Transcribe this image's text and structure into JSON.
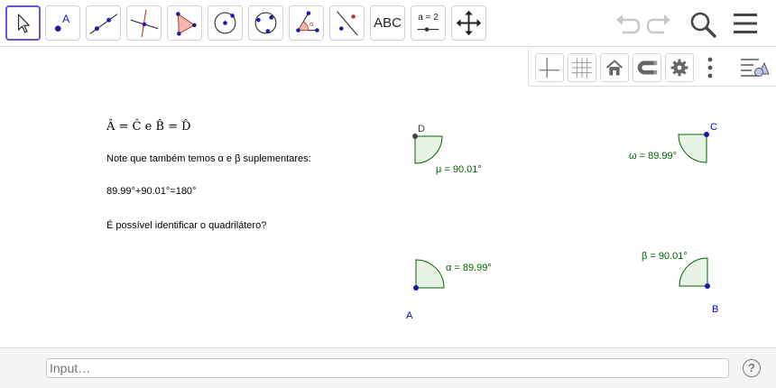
{
  "toolbar": {
    "tools": [
      {
        "name": "move"
      },
      {
        "name": "point",
        "label": "A"
      },
      {
        "name": "line"
      },
      {
        "name": "perpendicular-line"
      },
      {
        "name": "polygon"
      },
      {
        "name": "circle-center-point"
      },
      {
        "name": "circle-three-points"
      },
      {
        "name": "angle",
        "label": "α"
      },
      {
        "name": "reflect-about-line"
      },
      {
        "name": "text",
        "label": "ABC"
      },
      {
        "name": "slider",
        "label": "a = 2"
      },
      {
        "name": "move-graphics-view"
      }
    ],
    "active_color": "#6557d2"
  },
  "text": {
    "equality": "Â = Ĉ e B̂ = D̂",
    "line1": "Note que também temos α e β suplementares:",
    "line2": "89.99°+90.01°=180°",
    "line3": "É possível identificar o quadrilátero?"
  },
  "points": {
    "A": "A",
    "B": "B",
    "C": "C",
    "D": "D"
  },
  "angles": {
    "mu": "μ = 90.01°",
    "omega": "ω = 89.99°",
    "alpha": "α = 89.99°",
    "beta": "β = 90.01°"
  },
  "colors": {
    "angle_stroke": "#006400",
    "angle_fill": "#e7f3e5",
    "point_blue": "#1a1aa6",
    "label_blue": "#0000cc"
  },
  "input": {
    "placeholder": "Input…",
    "help": "?"
  }
}
